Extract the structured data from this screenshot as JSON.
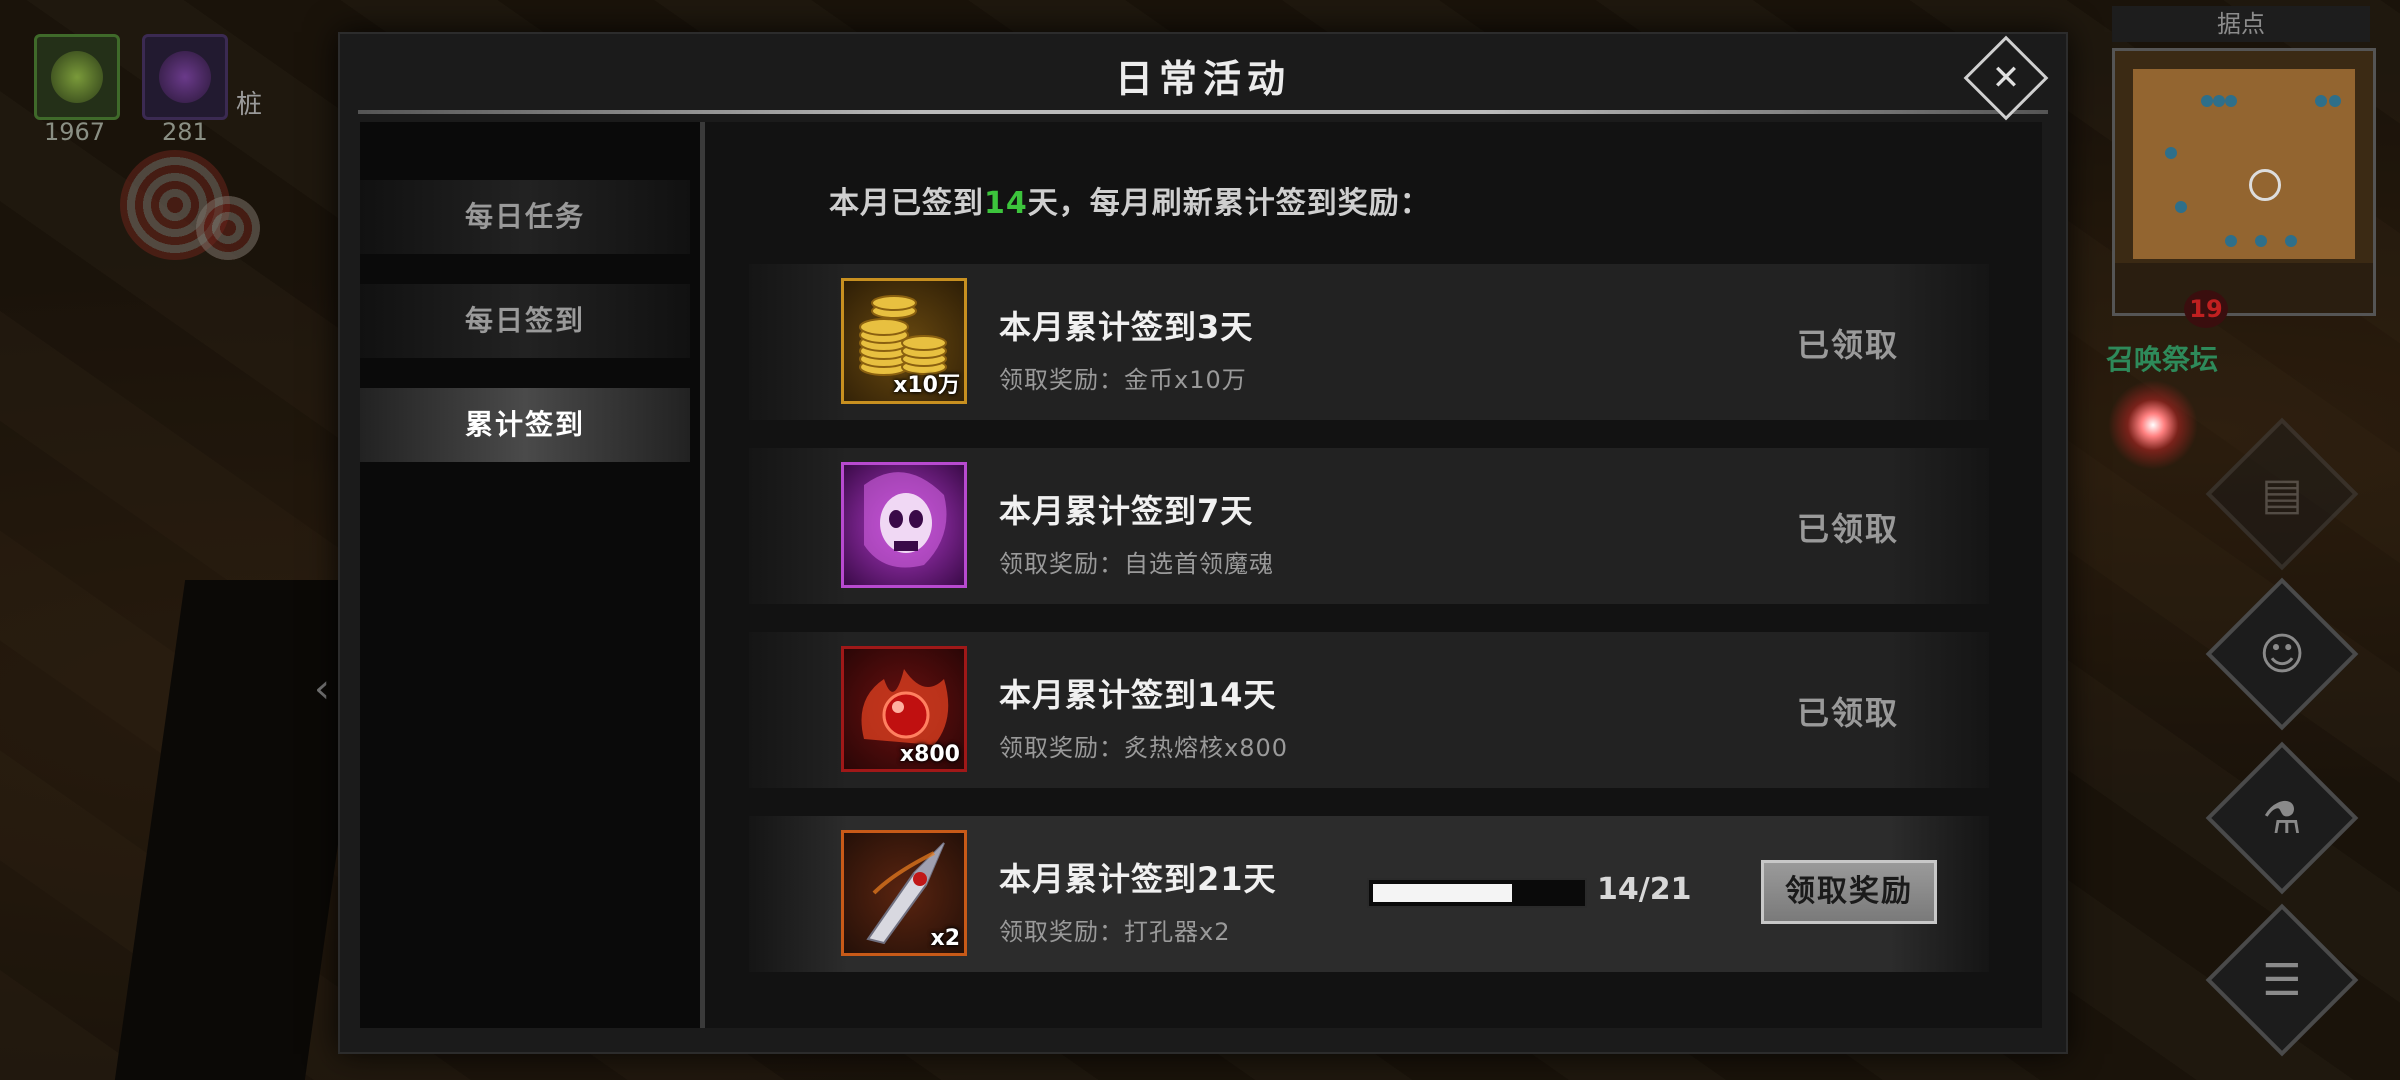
{
  "hud": {
    "slot1_count": "1967",
    "slot2_count": "281",
    "tag": "桩"
  },
  "minimap": {
    "title": "据点",
    "badge": "19",
    "altar_label": "召唤祭坛"
  },
  "dialog": {
    "title": "日常活动",
    "close_icon": "close-icon"
  },
  "tabs": [
    {
      "label": "每日任务",
      "active": false
    },
    {
      "label": "每日签到",
      "active": false
    },
    {
      "label": "累计签到",
      "active": true
    }
  ],
  "summary": {
    "prefix": "本月已签到",
    "days": "14",
    "suffix": "天，每月刷新累计签到奖励："
  },
  "rewards": [
    {
      "title": "本月累计签到3天",
      "desc": "领取奖励：金币x10万",
      "qty": "x10万",
      "icon": "gold-coins-icon",
      "status": "已领取"
    },
    {
      "title": "本月累计签到7天",
      "desc": "领取奖励：自选首领魔魂",
      "qty": "",
      "icon": "skull-soul-icon",
      "status": "已领取"
    },
    {
      "title": "本月累计签到14天",
      "desc": "领取奖励：炙热熔核x800",
      "qty": "x800",
      "icon": "molten-core-icon",
      "status": "已领取"
    },
    {
      "title": "本月累计签到21天",
      "desc": "领取奖励：打孔器x2",
      "qty": "x2",
      "icon": "drill-blade-icon",
      "progress_text": "14/21",
      "progress_fraction": 0.667,
      "button": "领取奖励"
    }
  ],
  "colors": {
    "highlight_green": "#3cc43c",
    "gold_border": "#c89020",
    "purple_border": "#b84ad0",
    "red_border": "#a01818",
    "orange_border": "#c85a18"
  }
}
